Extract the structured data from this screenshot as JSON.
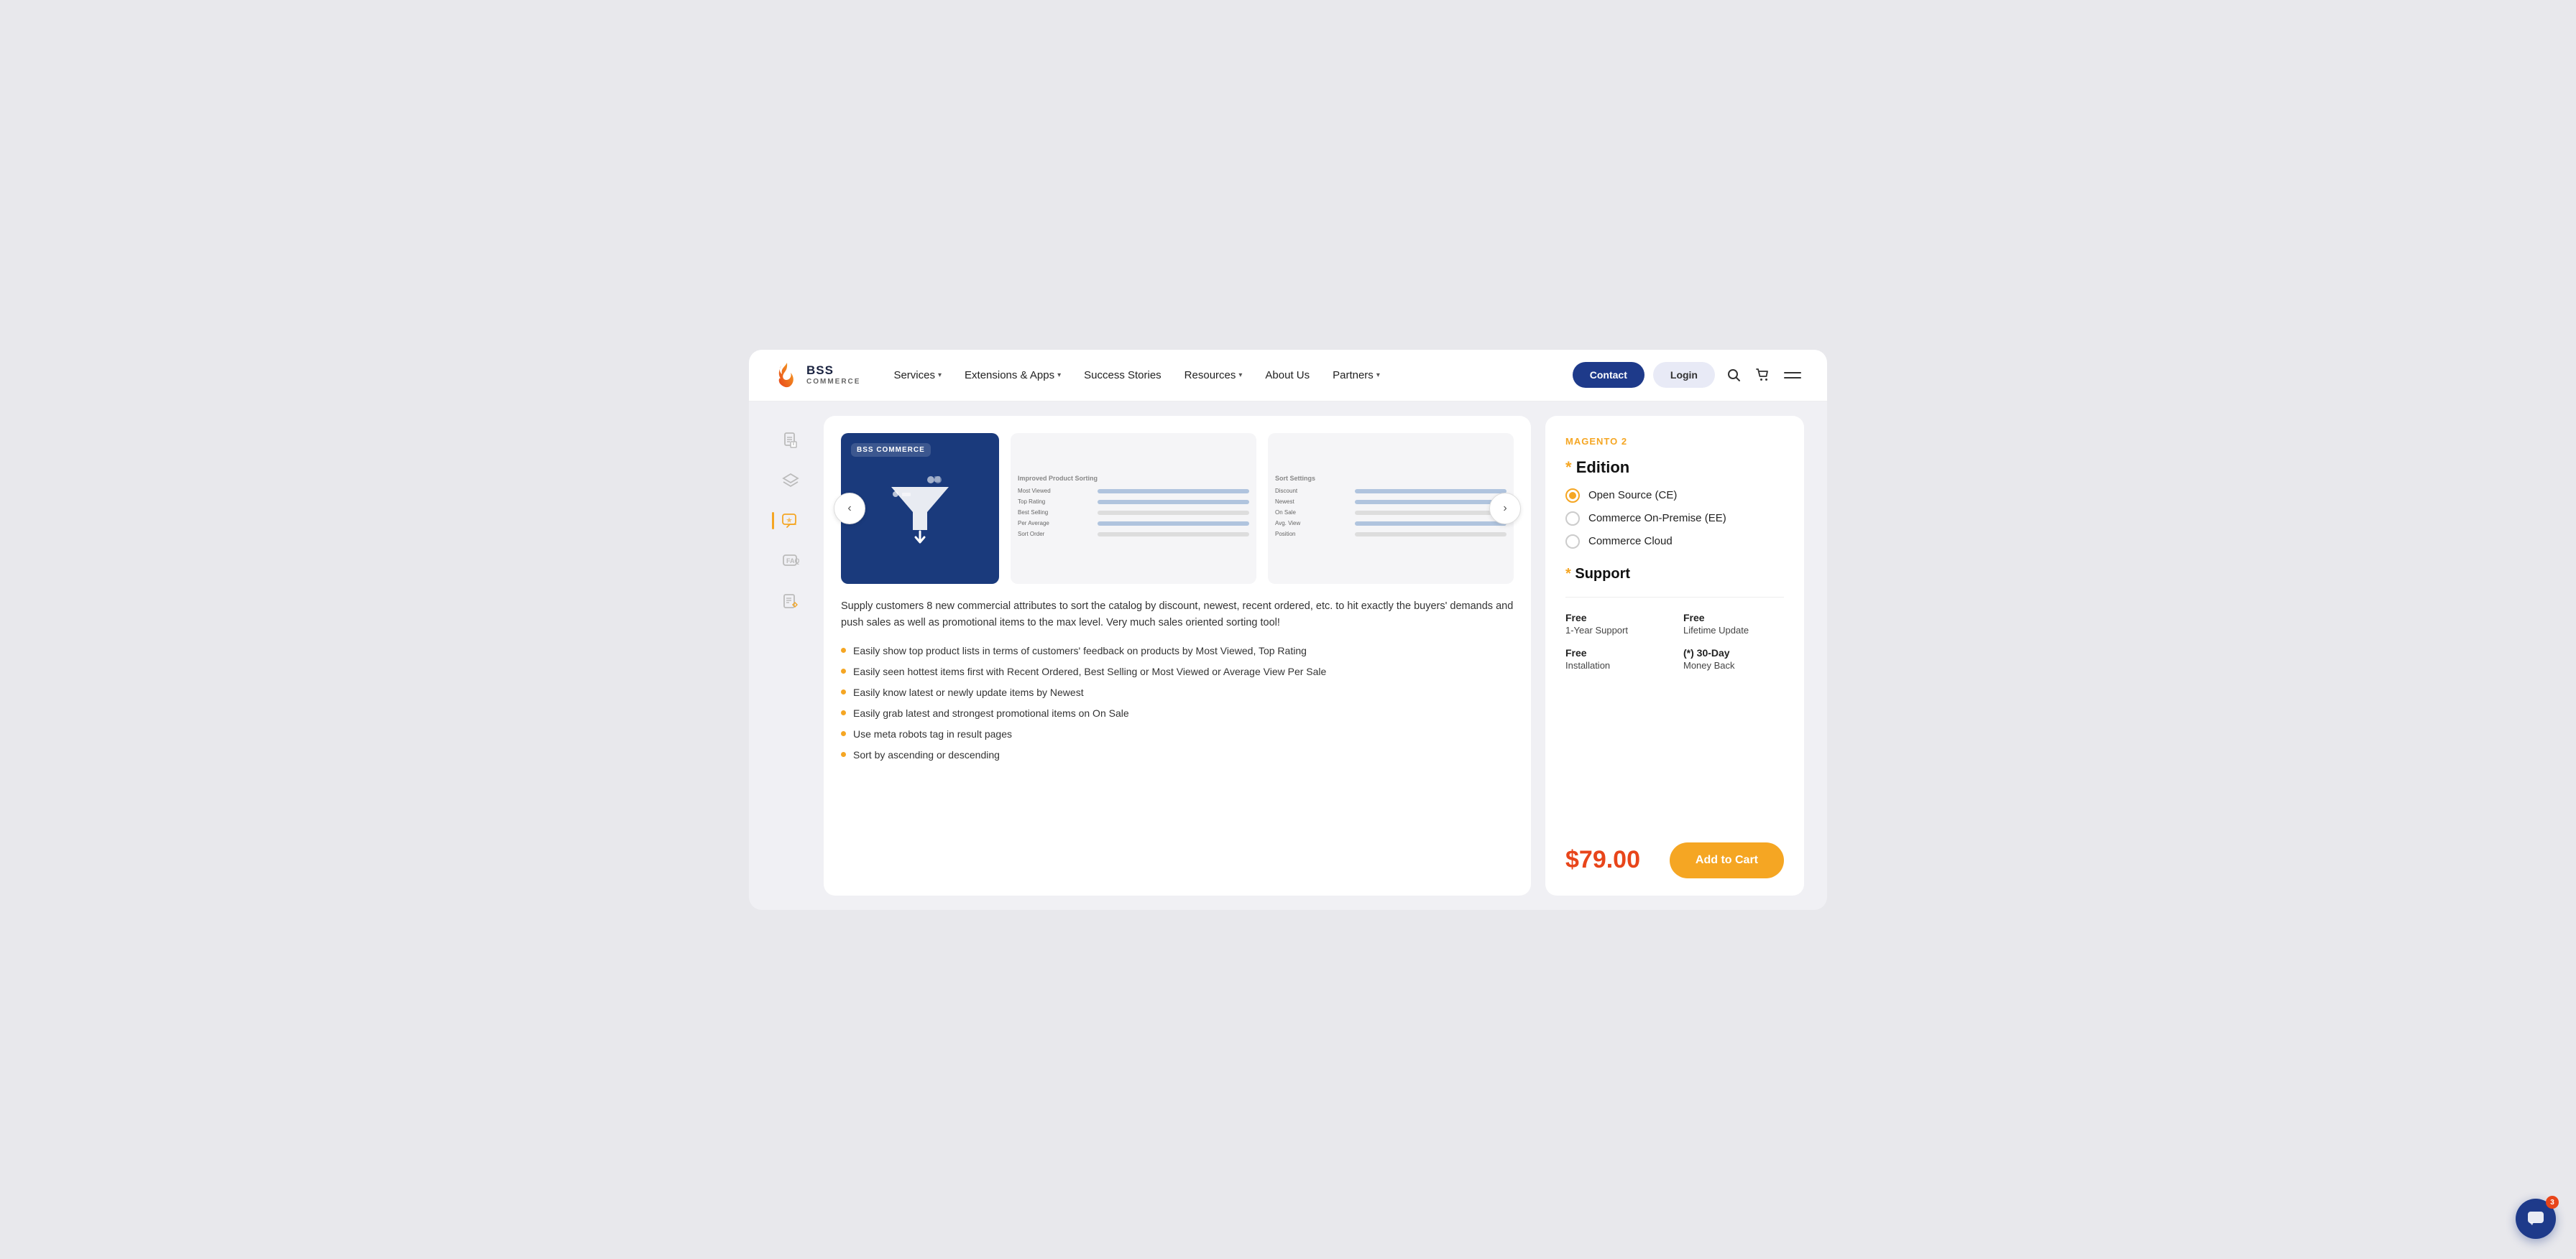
{
  "header": {
    "logo_bss": "BSS",
    "logo_commerce": "COMMERCE",
    "nav": [
      {
        "label": "Services",
        "has_dropdown": true
      },
      {
        "label": "Extensions & Apps",
        "has_dropdown": true
      },
      {
        "label": "Success Stories",
        "has_dropdown": false
      },
      {
        "label": "Resources",
        "has_dropdown": true
      },
      {
        "label": "About Us",
        "has_dropdown": false
      },
      {
        "label": "Partners",
        "has_dropdown": true
      }
    ],
    "btn_contact": "Contact",
    "btn_login": "Login"
  },
  "sidebar": {
    "icons": [
      {
        "name": "document-icon",
        "glyph": "📋",
        "active": false
      },
      {
        "name": "layers-icon",
        "glyph": "◈",
        "active": false
      },
      {
        "name": "star-comment-icon",
        "glyph": "💬",
        "active": false
      },
      {
        "name": "qa-icon",
        "glyph": "❓",
        "active": false
      },
      {
        "name": "edit-icon",
        "glyph": "✏️",
        "active": false
      }
    ]
  },
  "product": {
    "description": "Supply customers 8 new commercial attributes to sort the catalog by discount, newest, recent ordered, etc. to hit exactly the buyers' demands and push sales as well as promotional items to the max level.  Very much sales oriented sorting tool!",
    "features": [
      "Easily show top product lists in terms of customers' feedback on products by Most Viewed, Top Rating",
      "Easily seen hottest items first with Recent Ordered, Best Selling or Most Viewed or Average View Per Sale",
      "Easily know latest or newly update items by Newest",
      "Easily grab latest and strongest promotional items on On Sale",
      "Use meta robots tag in result pages",
      "Sort by ascending or descending"
    ]
  },
  "right_panel": {
    "magento_label": "MAGENTO 2",
    "edition_label": "Edition",
    "edition_asterisk": "*",
    "edition_options": [
      {
        "label": "Open Source (CE)",
        "selected": true
      },
      {
        "label": "Commerce On-Premise (EE)",
        "selected": false
      },
      {
        "label": "Commerce Cloud",
        "selected": false
      }
    ],
    "support_label": "Support",
    "support_asterisk": "*",
    "support_items": [
      {
        "main": "Free",
        "sub": "1-Year Support"
      },
      {
        "main": "Free",
        "sub": "Lifetime Update"
      },
      {
        "main": "Free",
        "sub": "Installation"
      },
      {
        "main": "(*) 30-Day",
        "sub": "Money Back"
      }
    ],
    "price": "$79.00",
    "add_to_cart": "Add to Cart"
  },
  "chat": {
    "badge_count": "3",
    "glyph": "💬"
  }
}
